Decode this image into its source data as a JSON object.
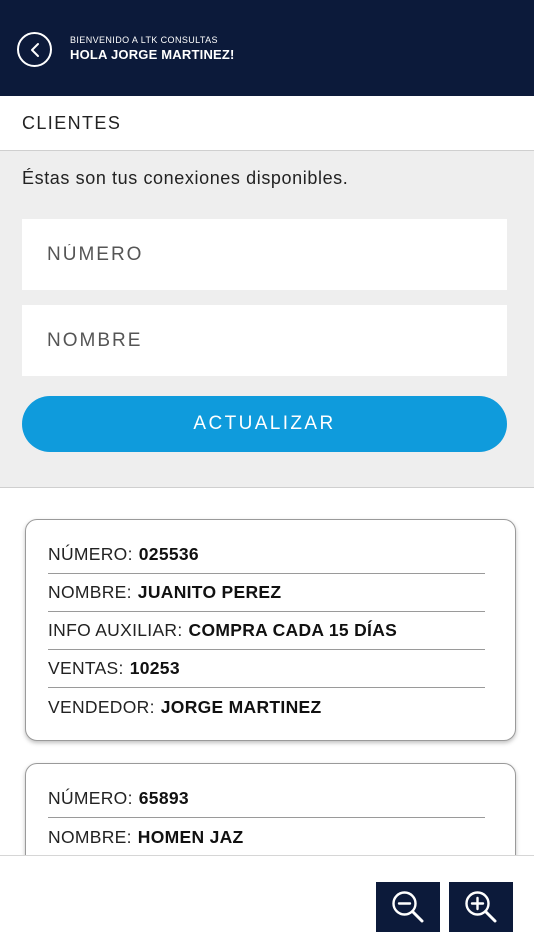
{
  "header": {
    "welcome": "BIENVENIDO A LTK CONSULTAS",
    "greeting": "HOLA JORGE MARTINEZ!"
  },
  "section": {
    "title": "CLIENTES"
  },
  "filters": {
    "intro": "Éstas son tus conexiones disponibles.",
    "numero_placeholder": "NÚMERO",
    "nombre_placeholder": "NOMBRE",
    "update_label": "ACTUALIZAR"
  },
  "clients": [
    {
      "numero_label": "NÚMERO:",
      "numero": "025536",
      "nombre_label": "NOMBRE:",
      "nombre": "JUANITO PEREZ",
      "info_label": "INFO AUXILIAR:",
      "info": "COMPRA CADA 15 DÍAS",
      "ventas_label": "VENTAS:",
      "ventas": "10253",
      "vendedor_label": "VENDEDOR:",
      "vendedor": "JORGE MARTINEZ"
    },
    {
      "numero_label": "NÚMERO:",
      "numero": "65893",
      "nombre_label": "NOMBRE:",
      "nombre": "HOMEN JAZ"
    }
  ],
  "icons": {
    "back": "chevron-left-icon",
    "zoom_out": "zoom-out-icon",
    "zoom_in": "zoom-in-icon"
  },
  "colors": {
    "header_bg": "#0c1a3a",
    "accent": "#0f9bdc",
    "panel_bg": "#eeeeee"
  }
}
